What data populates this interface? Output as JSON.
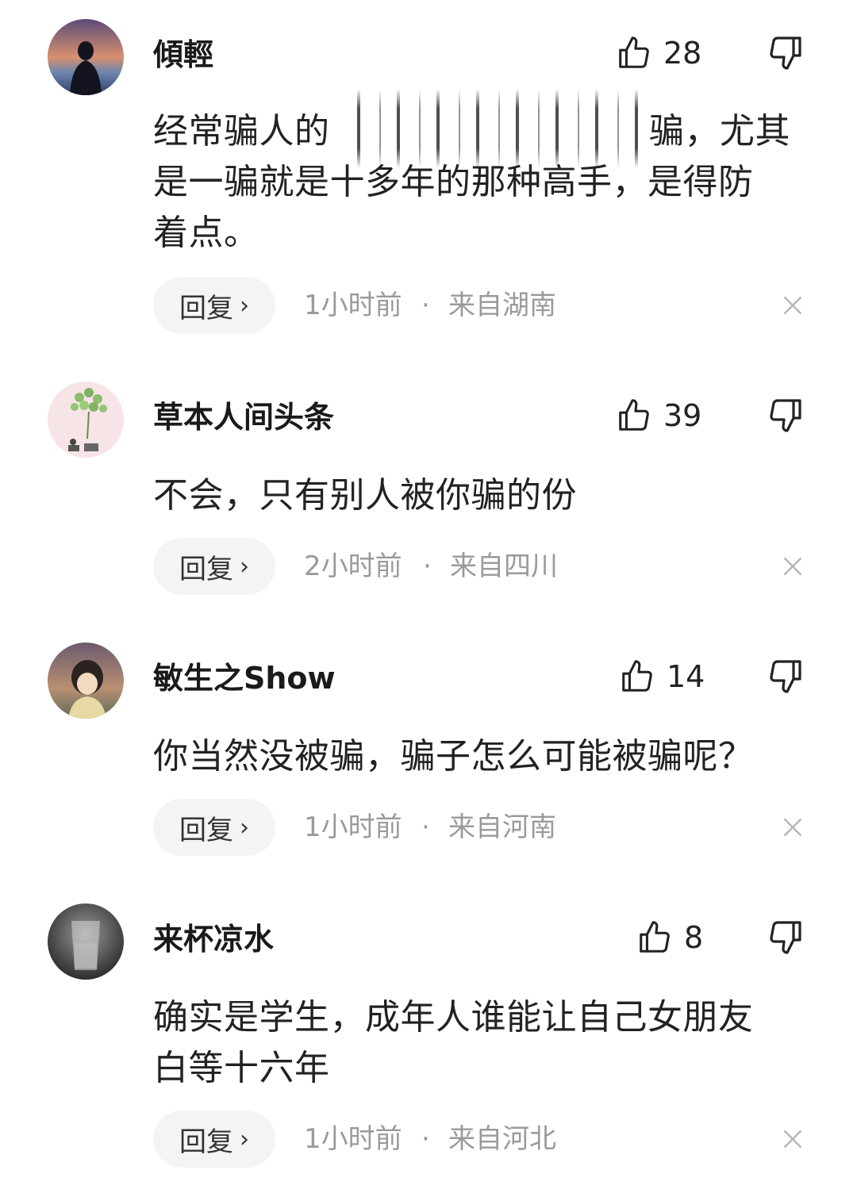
{
  "comments": [
    {
      "username": "傾輕",
      "likes": "28",
      "text_lines": [
        "经常骗人的人",
        "是一骗就是十多年的那种高手，是得防",
        "着点。"
      ],
      "text_line1_left": "经常骗人的",
      "text_line1_right": "骗，尤其",
      "reply_label": "回复",
      "time": "1小时前",
      "location": "来自湖南"
    },
    {
      "username": "草本人间头条",
      "likes": "39",
      "text": "不会，只有别人被你骗的份",
      "reply_label": "回复",
      "time": "2小时前",
      "location": "来自四川"
    },
    {
      "username": "敏生之Show",
      "likes": "14",
      "text": "你当然没被骗，骗子怎么可能被骗呢？",
      "reply_label": "回复",
      "time": "1小时前",
      "location": "来自河南"
    },
    {
      "username": "来杯凉水",
      "likes": "8",
      "text_lines": [
        "确实是学生，成年人谁能让自己女朋友",
        "白等十六年"
      ],
      "reply_label": "回复",
      "time": "1小时前",
      "location": "来自河北"
    }
  ],
  "separator": "·",
  "icons": {
    "like": "thumbs-up-icon",
    "dislike": "thumbs-down-icon",
    "close": "close-icon",
    "chevron": "chevron-right-icon"
  },
  "colors": {
    "meta_text": "#9a9a9a",
    "reply_bg": "#f4f4f4",
    "text": "#222222"
  }
}
